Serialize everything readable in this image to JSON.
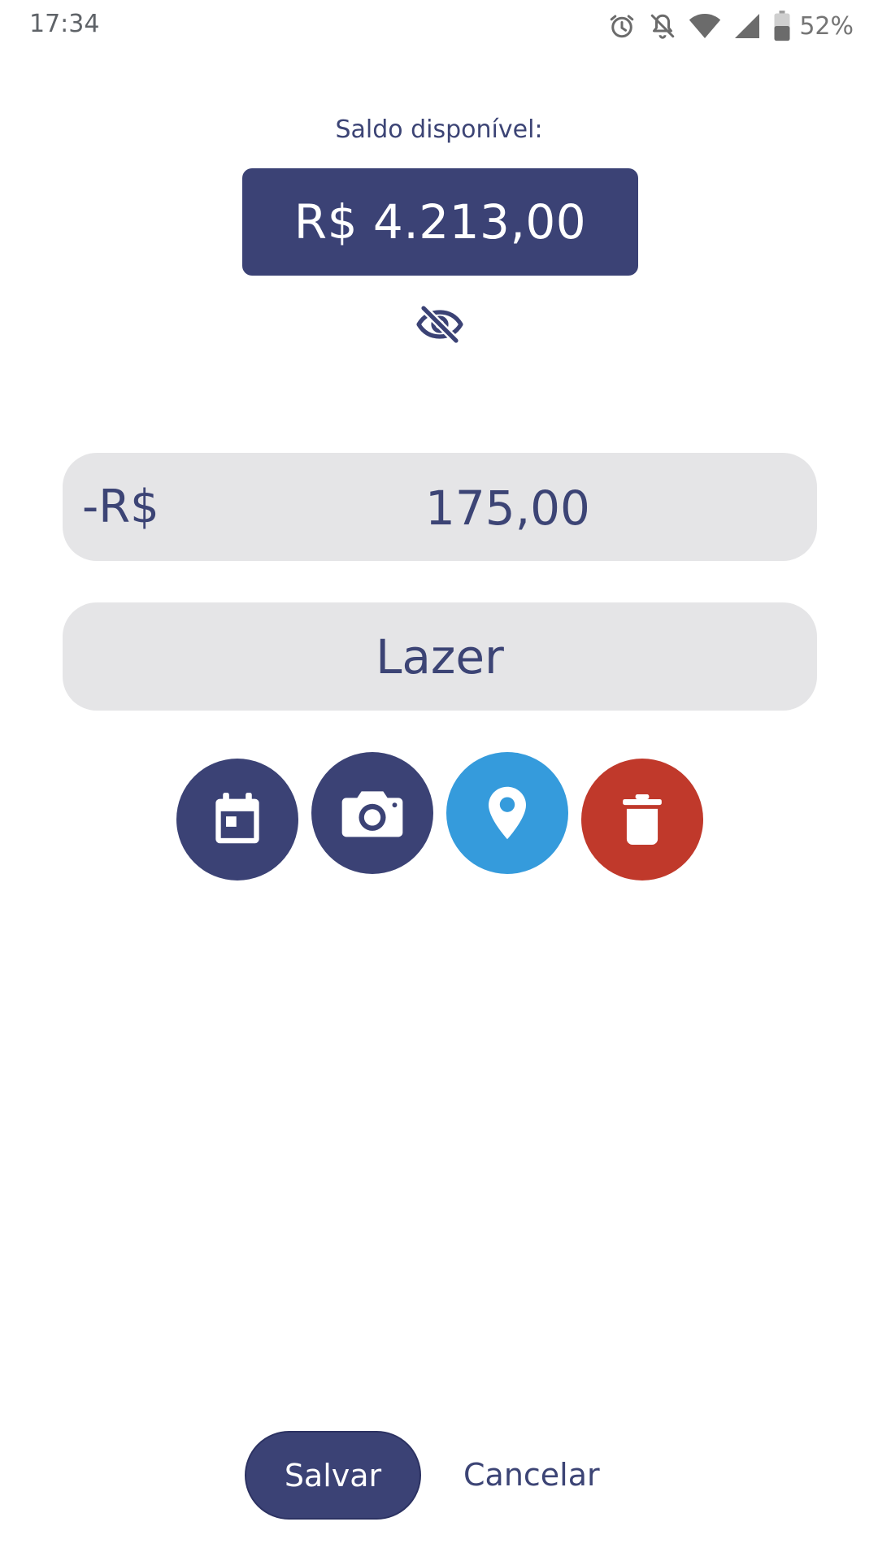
{
  "status_bar": {
    "time": "17:34",
    "battery_percent": "52%",
    "icons": [
      "alarm-icon",
      "notifications-off-icon",
      "wifi-icon",
      "cellular-signal-icon",
      "battery-icon"
    ]
  },
  "balance": {
    "label": "Saldo disponível:",
    "value": "R$ 4.213,00",
    "visibility_icon": "eye-off-icon"
  },
  "amount_field": {
    "prefix": "-R$",
    "value": "175,00"
  },
  "category_field": {
    "value": "Lazer"
  },
  "actions": [
    {
      "name": "calendar",
      "icon": "calendar-icon",
      "color": "#3b4275"
    },
    {
      "name": "camera",
      "icon": "camera-icon",
      "color": "#3b4275"
    },
    {
      "name": "location",
      "icon": "location-pin-icon",
      "color": "#359bdc"
    },
    {
      "name": "delete",
      "icon": "trash-icon",
      "color": "#c0392b"
    }
  ],
  "footer": {
    "save_label": "Salvar",
    "cancel_label": "Cancelar"
  },
  "colors": {
    "primary": "#3b4275",
    "field_background": "#e5e5e7",
    "accent_blue": "#359bdc",
    "danger_red": "#c0392b"
  }
}
